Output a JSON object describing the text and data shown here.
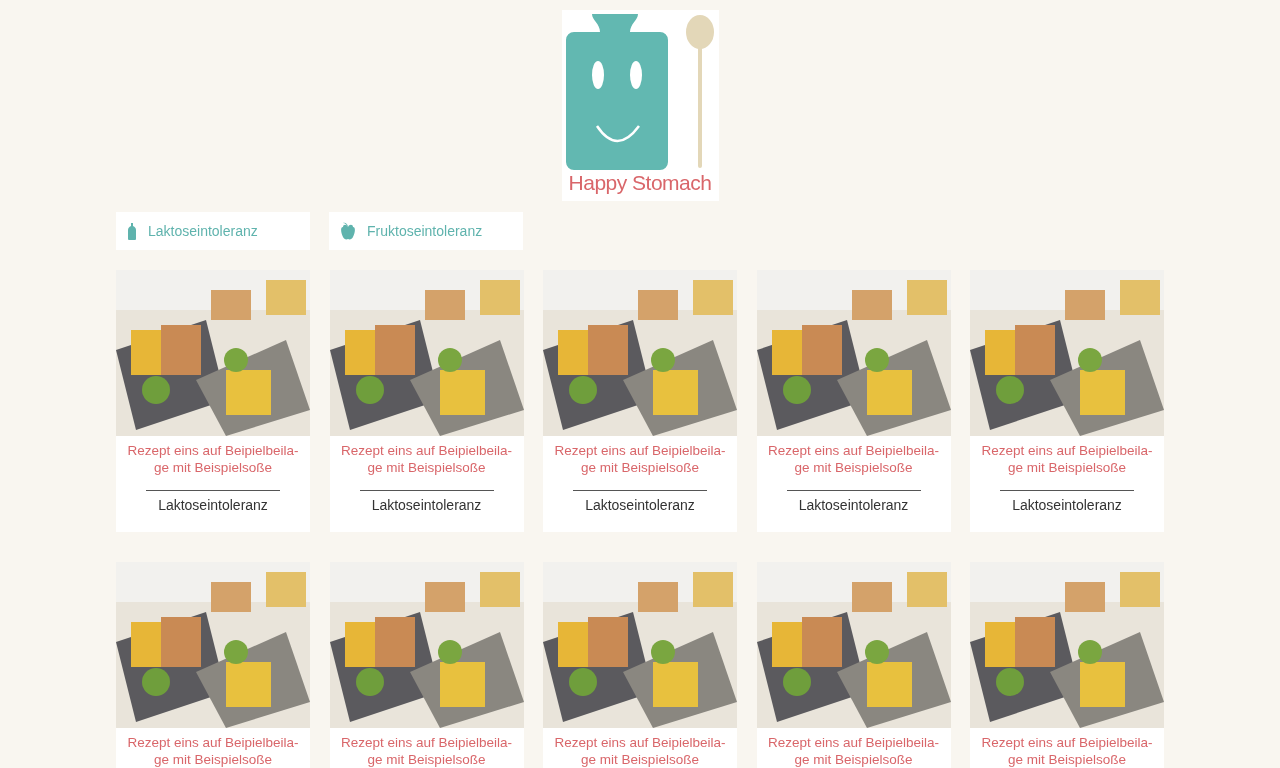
{
  "logo": {
    "wordmark": "Happy Stomach"
  },
  "filters": [
    {
      "kind": "bottle",
      "label": "Laktoseintoleranz"
    },
    {
      "kind": "apple",
      "label": "Fruktoseintoleranz"
    }
  ],
  "recipes": [
    {
      "title": "Rezept eins auf Beipielbeila-ge mit Beispielsoße",
      "category": "Laktoseintoleranz"
    },
    {
      "title": "Rezept eins auf Beipielbeila-ge mit Beispielsoße",
      "category": "Laktoseintoleranz"
    },
    {
      "title": "Rezept eins auf Beipielbeila-ge mit Beispielsoße",
      "category": "Laktoseintoleranz"
    },
    {
      "title": "Rezept eins auf Beipielbeila-ge mit Beispielsoße",
      "category": "Laktoseintoleranz"
    },
    {
      "title": "Rezept eins auf Beipielbeila-ge mit Beispielsoße",
      "category": "Laktoseintoleranz"
    },
    {
      "title": "Rezept eins auf Beipielbeila-ge mit Beispielsoße"
    },
    {
      "title": "Rezept eins auf Beipielbeila-ge mit Beispielsoße"
    },
    {
      "title": "Rezept eins auf Beipielbeila-ge mit Beispielsoße"
    },
    {
      "title": "Rezept eins auf Beipielbeila-ge mit Beispielsoße"
    },
    {
      "title": "Rezept eins auf Beipielbeila-ge mit Beispielsoße"
    }
  ]
}
